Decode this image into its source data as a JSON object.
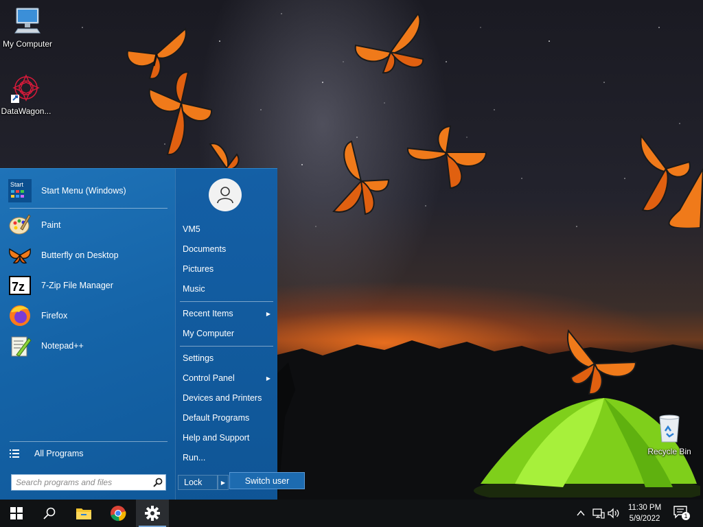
{
  "desktop": {
    "icons": [
      {
        "label": "My Computer",
        "icon": "computer-icon"
      },
      {
        "label": "DataWagon...",
        "icon": "datawagon-icon"
      },
      {
        "label": "Recycle Bin",
        "icon": "recycle-bin-icon"
      }
    ]
  },
  "start_menu": {
    "apps": [
      {
        "label": "Start Menu (Windows)",
        "icon": "start-menu-icon"
      },
      {
        "label": "Paint",
        "icon": "paint-icon"
      },
      {
        "label": "Butterfly on Desktop",
        "icon": "butterfly-icon"
      },
      {
        "label": "7-Zip File Manager",
        "icon": "7zip-icon"
      },
      {
        "label": "Firefox",
        "icon": "firefox-icon"
      },
      {
        "label": "Notepad++",
        "icon": "notepadpp-icon"
      }
    ],
    "start_icon_text": "Start",
    "zip_icon_text": "7z",
    "all_programs": "All Programs",
    "search_placeholder": "Search programs and files",
    "right_items": {
      "user": "VM5",
      "documents": "Documents",
      "pictures": "Pictures",
      "music": "Music",
      "recent_items": "Recent Items",
      "my_computer": "My Computer",
      "settings": "Settings",
      "control_panel": "Control Panel",
      "devices_printers": "Devices and Printers",
      "default_programs": "Default Programs",
      "help_support": "Help and Support",
      "run": "Run..."
    },
    "lock": "Lock",
    "switch_user": "Switch user"
  },
  "taskbar": {
    "buttons": [
      "windows-start-icon",
      "search-icon",
      "file-explorer-icon",
      "chrome-icon",
      "settings-gear-icon"
    ],
    "time": "11:30 PM",
    "date": "5/9/2022",
    "notification_count": "1"
  },
  "colors": {
    "start_menu_blue": "#1564a8",
    "taskbar": "#101214",
    "butterfly_orange": "#f07a1a"
  }
}
